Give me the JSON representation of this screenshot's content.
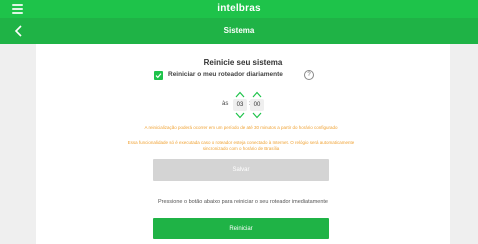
{
  "header": {
    "brand": "intelbras",
    "menu_icon": "menu-icon",
    "page_title": "Sistema",
    "back_icon": "chevron-left-icon"
  },
  "main": {
    "heading": "Reinicie seu sistema",
    "daily_restart": {
      "checked": true,
      "label": "Reiniciar o meu roteador diariamente",
      "help_icon": "?"
    },
    "schedule": {
      "prefix": "às",
      "hour": "03",
      "separator": ":",
      "minute": "00"
    },
    "warning_line1": "A reinicialização poderá ocorrer em um período de até 30 minutos a partir do horário configurado",
    "warning_line2": "Essa funcionalidade só é executada caso o roteador esteja conectado à Internet. O relógio será automaticamente sincronizado com o horário de Brasília",
    "save_label": "Salvar",
    "restart_text": "Pressione o botão abaixo para reiniciar o seu roteador imediatamente",
    "restart_label": "Reiniciar"
  },
  "colors": {
    "brand_green": "#1ec34a",
    "header_green": "#1fb346",
    "warning_orange": "#f0a233",
    "disabled_gray": "#d4d4d4"
  }
}
